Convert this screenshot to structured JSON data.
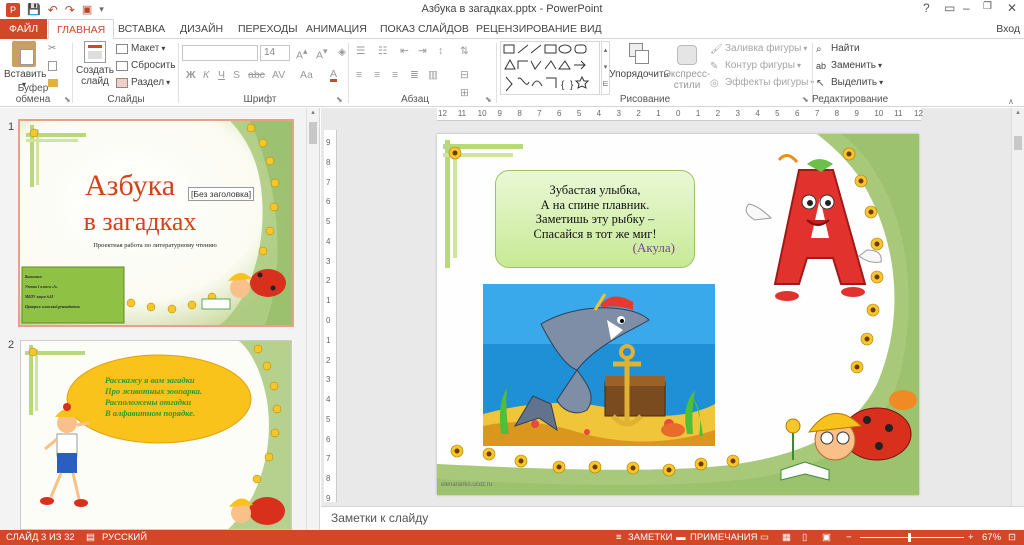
{
  "window": {
    "title": "Азбука в загадках.pptx - PowerPoint",
    "help": "?",
    "minimize": "–",
    "restore": "❐",
    "close": "✕"
  },
  "qat": {
    "save": "💾",
    "undo": "↶",
    "redo": "↷",
    "present": "▣",
    "more": "▾"
  },
  "tabs": {
    "file": "ФАЙЛ",
    "home": "ГЛАВНАЯ",
    "insert": "ВСТАВКА",
    "design": "ДИЗАЙН",
    "transitions": "ПЕРЕХОДЫ",
    "animations": "АНИМАЦИЯ",
    "slideshow": "ПОКАЗ СЛАЙДОВ",
    "review": "РЕЦЕНЗИРОВАНИЕ",
    "view": "ВИД",
    "signin": "Вход"
  },
  "ribbon": {
    "clipboard": {
      "paste": "Вставить",
      "group": "Буфер обмена"
    },
    "slides": {
      "new_slide_1": "Создать",
      "new_slide_2": "слайд",
      "layout": "Макет",
      "reset": "Сбросить",
      "section": "Раздел",
      "group": "Слайды"
    },
    "font": {
      "size": "14",
      "group": "Шрифт",
      "bold": "Ж",
      "italic": "К",
      "underline": "Ч",
      "strike": "S",
      "shadow": "abc",
      "spacing": "AV",
      "case": "Aa",
      "color": "A"
    },
    "paragraph": {
      "group": "Абзац"
    },
    "drawing": {
      "arrange_1": "Упорядочить",
      "styles_1": "Экспресс-",
      "styles_2": "стили",
      "fill": "Заливка фигуры",
      "outline": "Контур фигуры",
      "effects": "Эффекты фигуры",
      "group": "Рисование"
    },
    "editing": {
      "find": "Найти",
      "replace": "Заменить",
      "select": "Выделить",
      "group": "Редактирование"
    }
  },
  "thumbs": {
    "slide1": {
      "num": "1",
      "title_1": "Азбука",
      "title_2": "в загадках",
      "tooltip": "[Без заголовка]",
      "subtitle": "Проектная работа по литературному чтению",
      "box_1": "Выполнил:",
      "box_2": "Ученик 1 класса «А»",
      "box_3": "МБОУ лицея №18",
      "box_4": "Проверил: классный руководитель"
    },
    "slide2": {
      "num": "2",
      "line_1": "Расскажу я вам загадки",
      "line_2": "Про животных зоопарка.",
      "line_3": "Расположены отгадки",
      "line_4": "В алфавитном порядке."
    }
  },
  "ruler": {
    "h_ticks": [
      "12",
      "11",
      "10",
      "9",
      "8",
      "7",
      "6",
      "5",
      "4",
      "3",
      "2",
      "1",
      "0",
      "1",
      "2",
      "3",
      "4",
      "5",
      "6",
      "7",
      "8",
      "9",
      "10",
      "11",
      "12"
    ],
    "v_ticks": [
      "9",
      "8",
      "7",
      "6",
      "5",
      "4",
      "3",
      "2",
      "1",
      "0",
      "1",
      "2",
      "3",
      "4",
      "5",
      "6",
      "7",
      "8",
      "9"
    ]
  },
  "slide": {
    "riddle_1": "Зубастая улыбка,",
    "riddle_2": "А на спине плавник.",
    "riddle_3": "Заметишь эту рыбку –",
    "riddle_4": "Спасайся в тот же миг!",
    "answer": "(Акула)",
    "letter": "А",
    "credit": "elenaranko.ucoz.ru"
  },
  "notes": {
    "placeholder": "Заметки к слайду"
  },
  "status": {
    "slide_of": "СЛАЙД 3 ИЗ 32",
    "language": "РУССКИЙ",
    "notes": "ЗАМЕТКИ",
    "comments": "ПРИМЕЧАНИЯ",
    "zoom": "67%",
    "minus": "−",
    "plus": "+"
  },
  "colors": {
    "accent": "#d24726",
    "selection": "#e5a18c",
    "title_red": "#d4421c",
    "slide_green": "#a8c97a"
  }
}
